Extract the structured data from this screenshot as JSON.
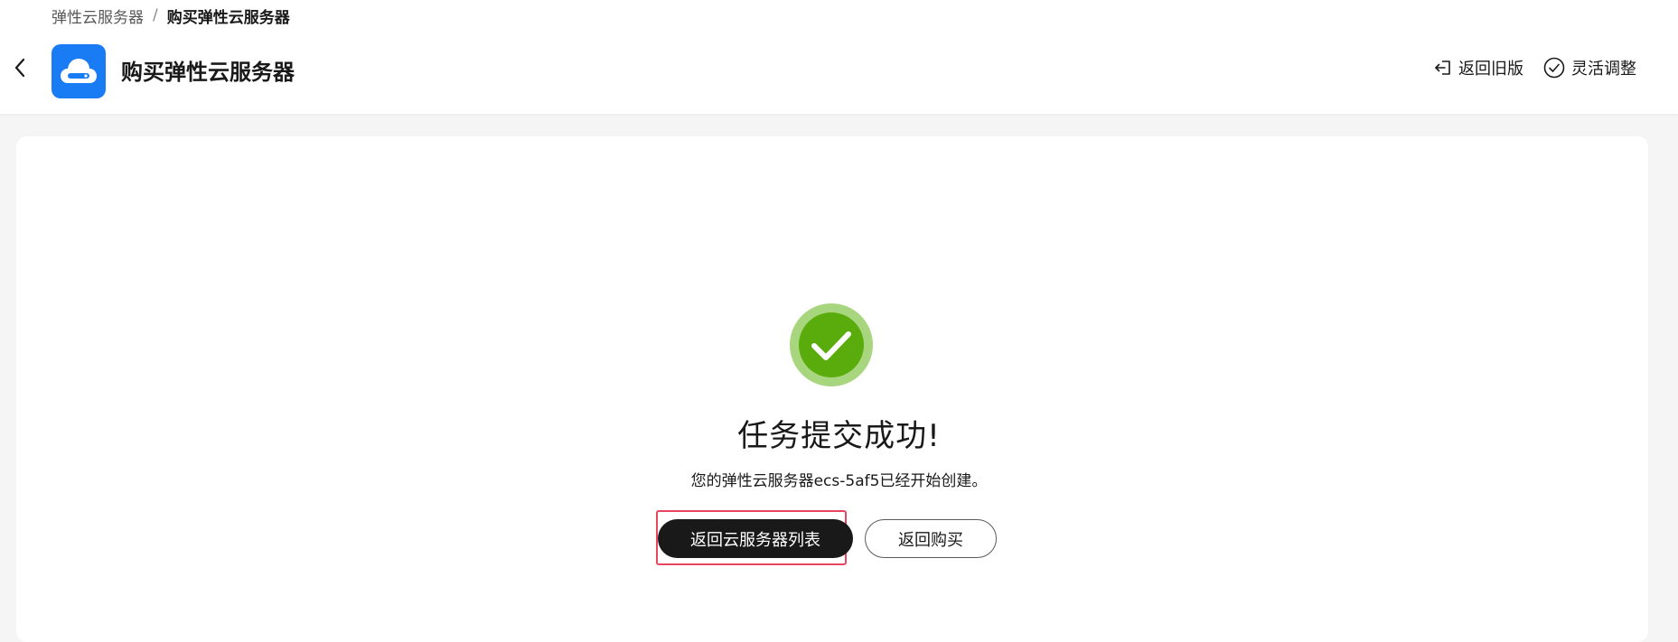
{
  "breadcrumb": {
    "parent": "弹性云服务器",
    "separator": "/",
    "current": "购买弹性云服务器"
  },
  "header": {
    "title": "购买弹性云服务器",
    "logo_icon": "cloud-server-icon",
    "back_icon": "chevron-left-icon",
    "actions": [
      {
        "label": "返回旧版",
        "icon": "exit-icon"
      },
      {
        "label": "灵活调整",
        "icon": "check-circle-icon"
      }
    ]
  },
  "result": {
    "icon": "success-check-icon",
    "title": "任务提交成功!",
    "description": "您的弹性云服务器ecs-5af5已经开始创建。",
    "primary_button": "返回云服务器列表",
    "secondary_button": "返回购买"
  },
  "colors": {
    "brand_blue": "#1a7cf4",
    "success_green": "#5aac0c",
    "success_ring": "#a8d67e",
    "primary_button_bg": "#191919",
    "highlight_border": "#e8455e"
  }
}
